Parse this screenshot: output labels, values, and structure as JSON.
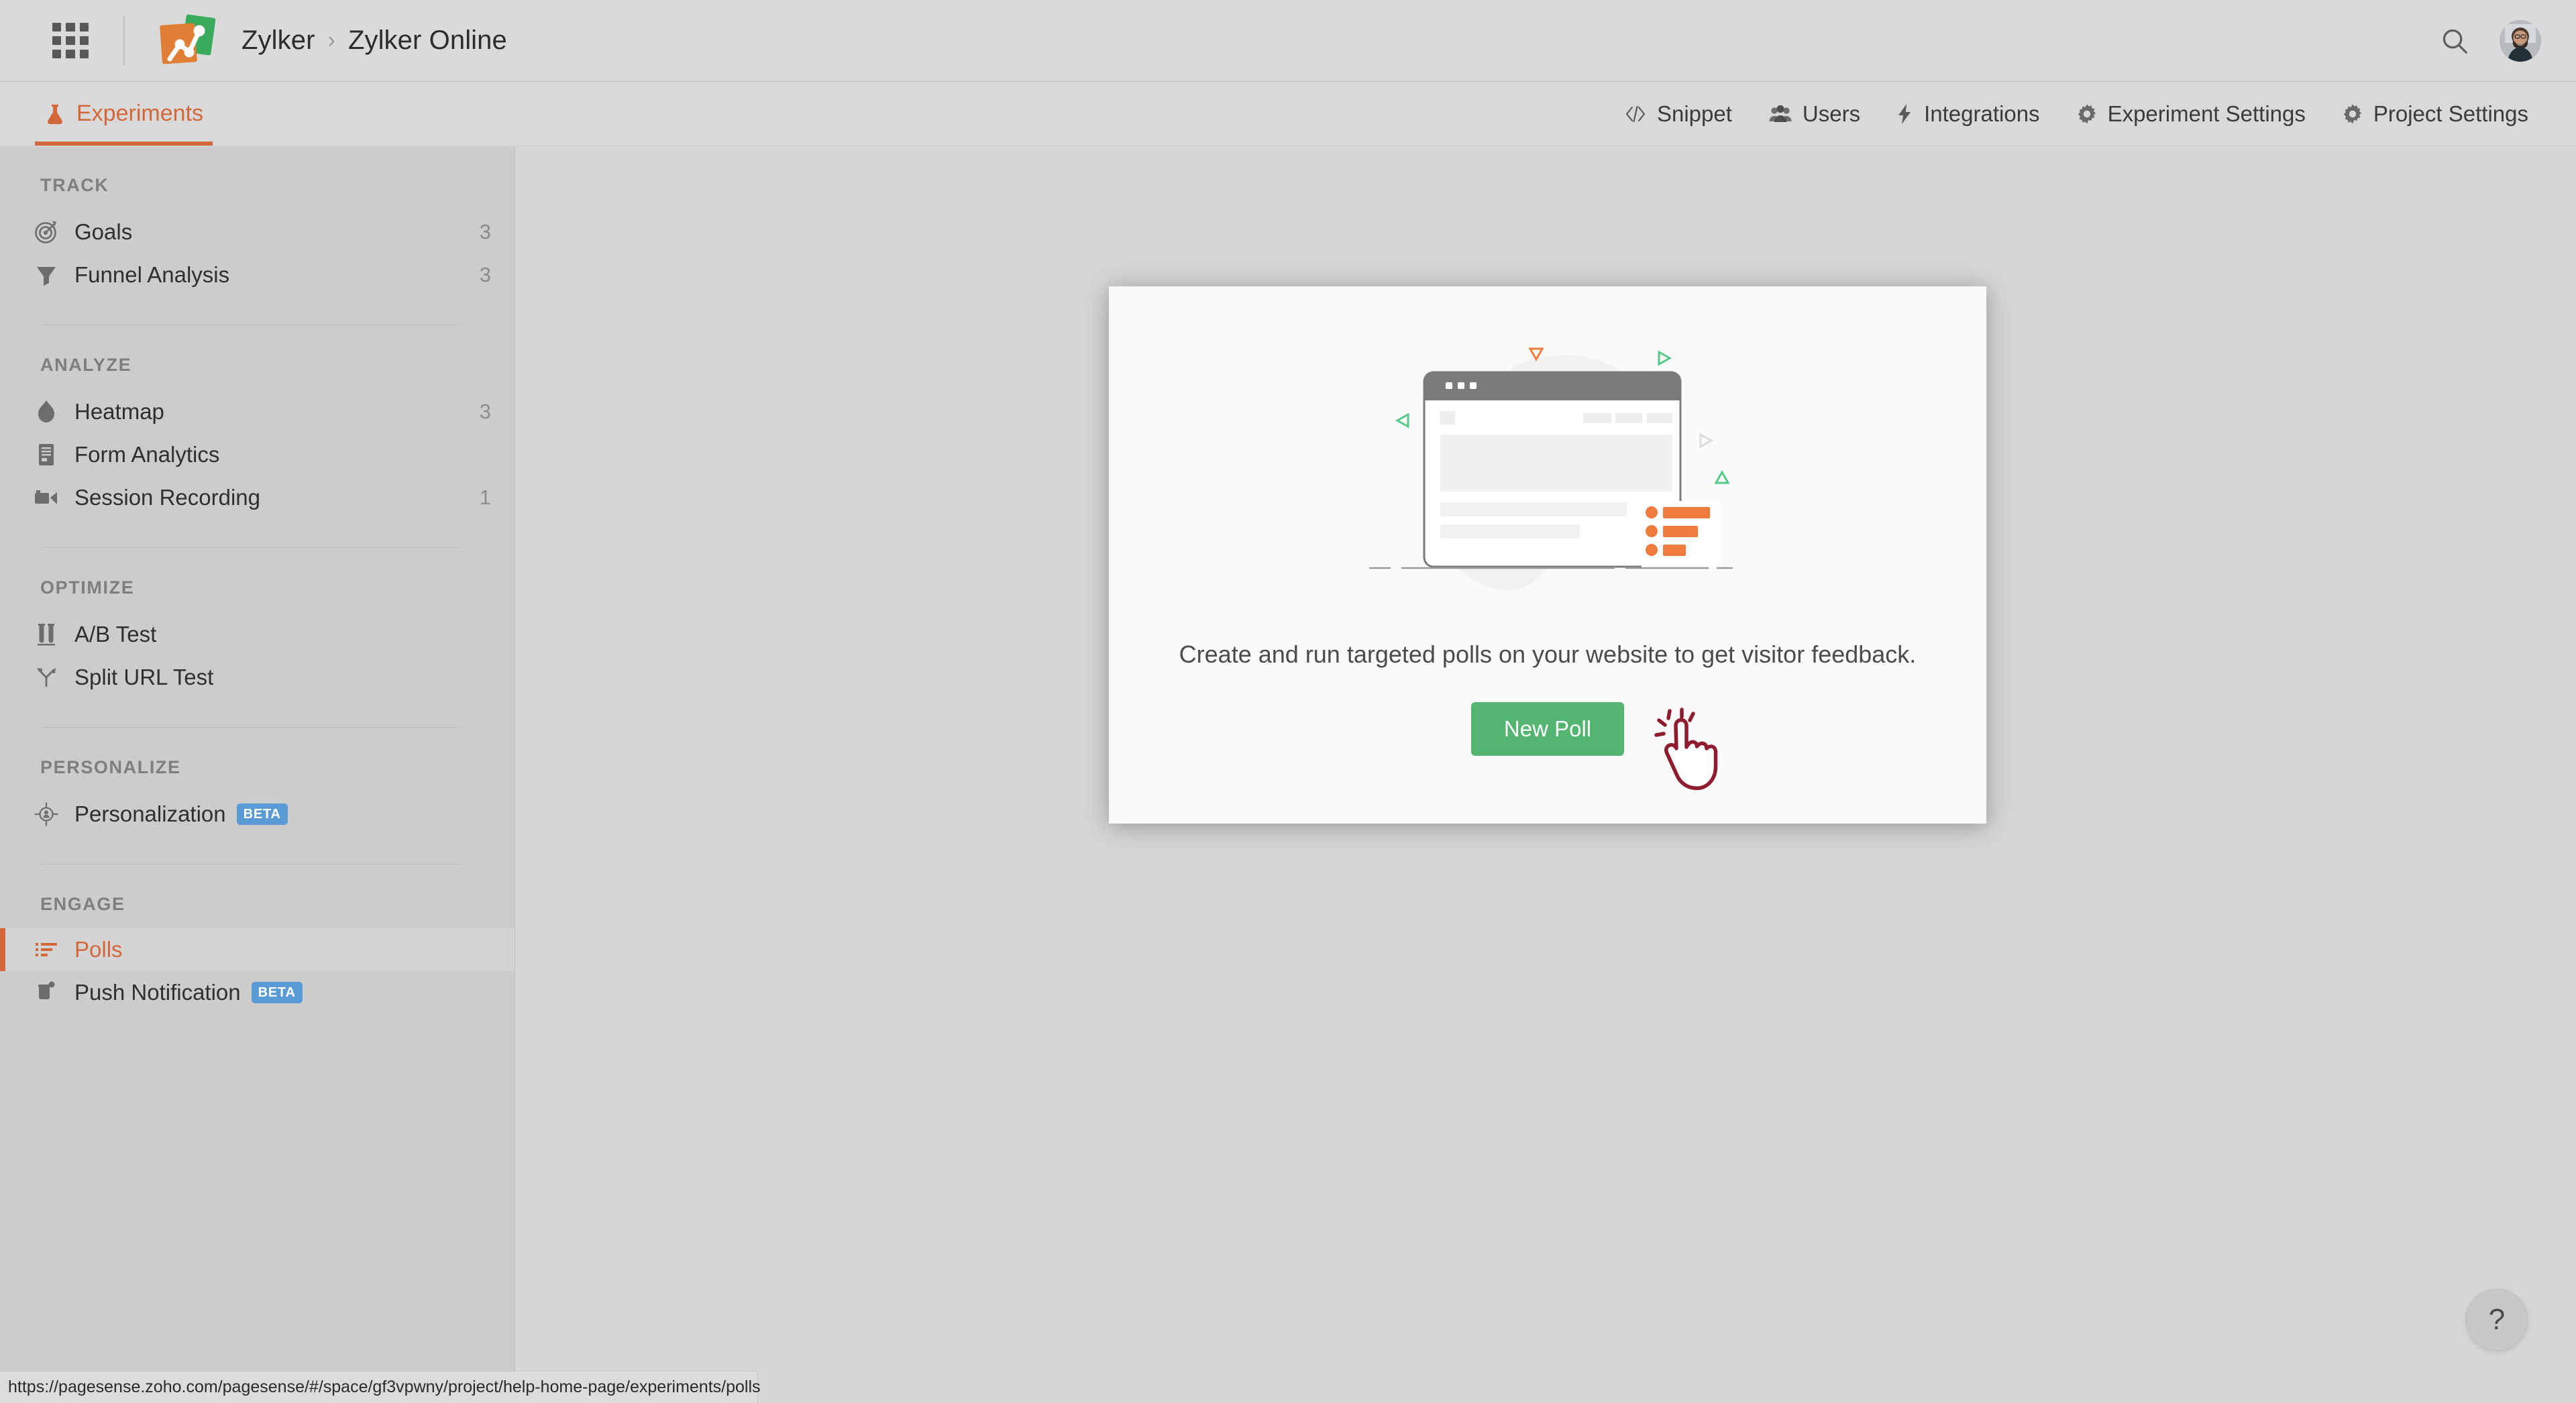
{
  "header": {
    "apps_icon": "grid-apps-icon",
    "logo_icon": "pagesense-logo-icon",
    "breadcrumb": {
      "org": "Zylker",
      "separator": "›",
      "project": "Zylker Online"
    },
    "search_icon": "search-icon",
    "avatar_icon": "user-avatar"
  },
  "subnav": {
    "active_tab": {
      "label": "Experiments",
      "icon": "flask-icon",
      "color": "#d2683a"
    },
    "items": [
      {
        "label": "Snippet",
        "icon": "code-icon"
      },
      {
        "label": "Users",
        "icon": "users-icon"
      },
      {
        "label": "Integrations",
        "icon": "bolt-icon"
      },
      {
        "label": "Experiment Settings",
        "icon": "gear-icon"
      },
      {
        "label": "Project Settings",
        "icon": "gear-icon"
      }
    ]
  },
  "sidebar": {
    "groups": [
      {
        "title": "TRACK",
        "items": [
          {
            "label": "Goals",
            "icon": "target-icon",
            "count": "3",
            "badge": "",
            "active": false
          },
          {
            "label": "Funnel Analysis",
            "icon": "funnel-icon",
            "count": "3",
            "badge": "",
            "active": false
          }
        ]
      },
      {
        "title": "ANALYZE",
        "items": [
          {
            "label": "Heatmap",
            "icon": "flame-icon",
            "count": "3",
            "badge": "",
            "active": false
          },
          {
            "label": "Form Analytics",
            "icon": "form-icon",
            "count": "",
            "badge": "",
            "active": false
          },
          {
            "label": "Session Recording",
            "icon": "video-camera-icon",
            "count": "1",
            "badge": "",
            "active": false
          }
        ]
      },
      {
        "title": "OPTIMIZE",
        "items": [
          {
            "label": "A/B Test",
            "icon": "test-tubes-icon",
            "count": "",
            "badge": "",
            "active": false
          },
          {
            "label": "Split URL Test",
            "icon": "split-arrows-icon",
            "count": "",
            "badge": "",
            "active": false
          }
        ]
      },
      {
        "title": "PERSONALIZE",
        "items": [
          {
            "label": "Personalization",
            "icon": "crosshair-user-icon",
            "count": "",
            "badge": "BETA",
            "active": false
          }
        ]
      },
      {
        "title": "ENGAGE",
        "items": [
          {
            "label": "Polls",
            "icon": "poll-list-icon",
            "count": "",
            "badge": "",
            "active": true
          },
          {
            "label": "Push Notification",
            "icon": "push-bell-icon",
            "count": "",
            "badge": "BETA",
            "active": false
          }
        ]
      }
    ]
  },
  "main": {
    "empty_state": {
      "illustration": "browser-poll-illustration",
      "description": "Create and run targeted polls on your website to get visitor feedback.",
      "primary_button": "New Poll",
      "cursor_icon": "click-hand-cursor"
    }
  },
  "help": {
    "label": "?",
    "icon": "question-mark-icon"
  },
  "status_bar": {
    "url": "https://pagesense.zoho.com/pagesense/#/space/gf3vpwny/project/help-home-page/experiments/polls"
  },
  "colors": {
    "accent_orange": "#d2683a",
    "primary_green": "#54b571",
    "beta_blue": "#5b9bd5",
    "page_bg": "#d6d6d6",
    "sidebar_bg": "#cccccc",
    "card_bg": "#fafafa",
    "cursor_maroon": "#8e1b2e"
  }
}
